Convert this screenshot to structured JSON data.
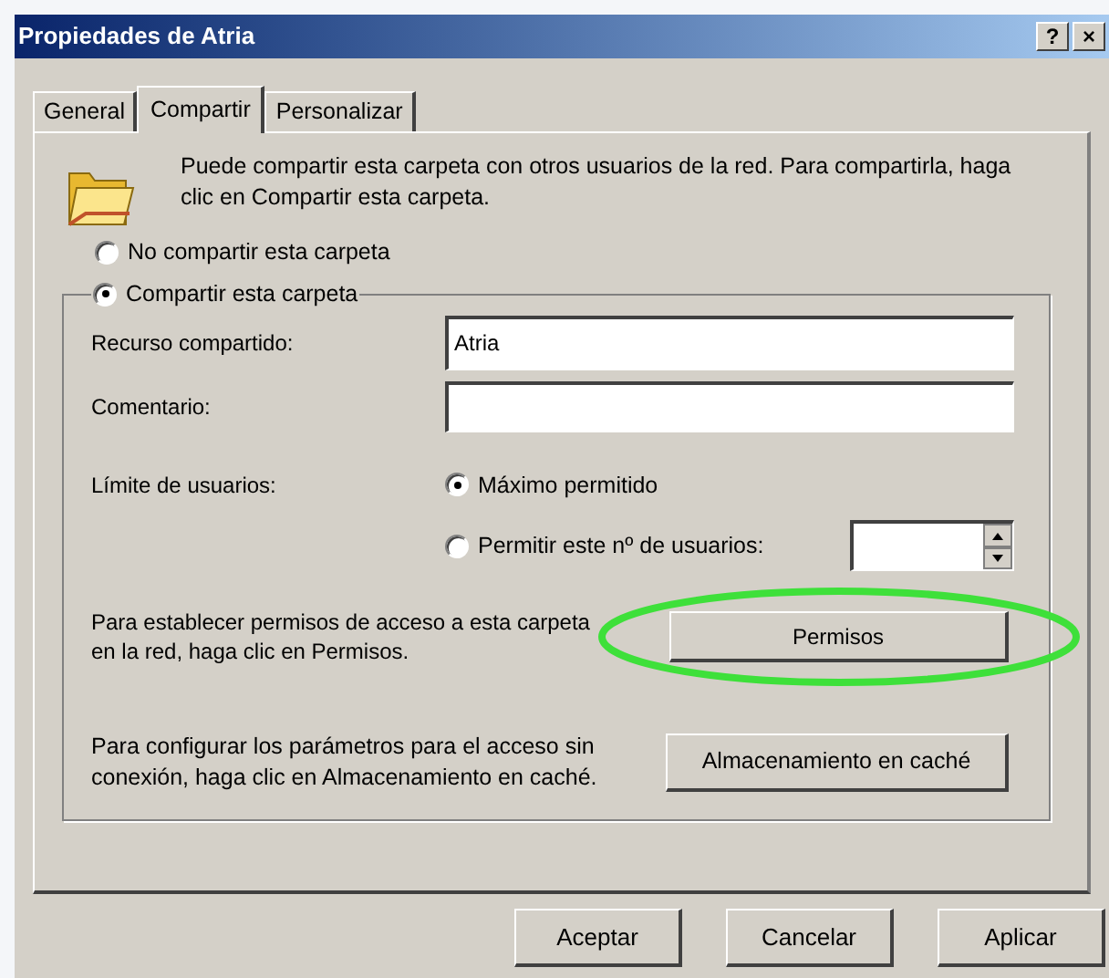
{
  "window": {
    "title": "Propiedades de Atria",
    "controls": [
      "?",
      "×"
    ]
  },
  "tabs": [
    {
      "label": "General",
      "selected": false
    },
    {
      "label": "Compartir",
      "selected": true
    },
    {
      "label": "Personalizar",
      "selected": false
    }
  ],
  "intro": "Puede compartir esta carpeta con otros usuarios de la red. Para compartirla, haga clic en Compartir esta carpeta.",
  "share_options": [
    {
      "label": "No compartir esta carpeta",
      "selected": false
    },
    {
      "label": "Compartir esta carpeta",
      "selected": true
    }
  ],
  "share_name": {
    "label": "Recurso compartido:",
    "value": "Atria"
  },
  "comment": {
    "label": "Comentario:"
  },
  "user_limit": {
    "label": "Límite de usuarios:",
    "options": [
      {
        "label": "Máximo permitido",
        "selected": true
      },
      {
        "label": "Permitir este nº de usuarios:",
        "selected": false
      }
    ]
  },
  "permissions": {
    "text": "Para establecer permisos de acceso a esta carpeta en la red, haga clic en Permisos.",
    "button": "Permisos",
    "highlighted": true
  },
  "caching": {
    "text": "Para configurar los parámetros para el acceso sin conexión, haga clic en Almacenamiento en caché.",
    "button": "Almacenamiento en caché"
  },
  "buttons": [
    "Aceptar",
    "Cancelar",
    "Aplicar"
  ]
}
